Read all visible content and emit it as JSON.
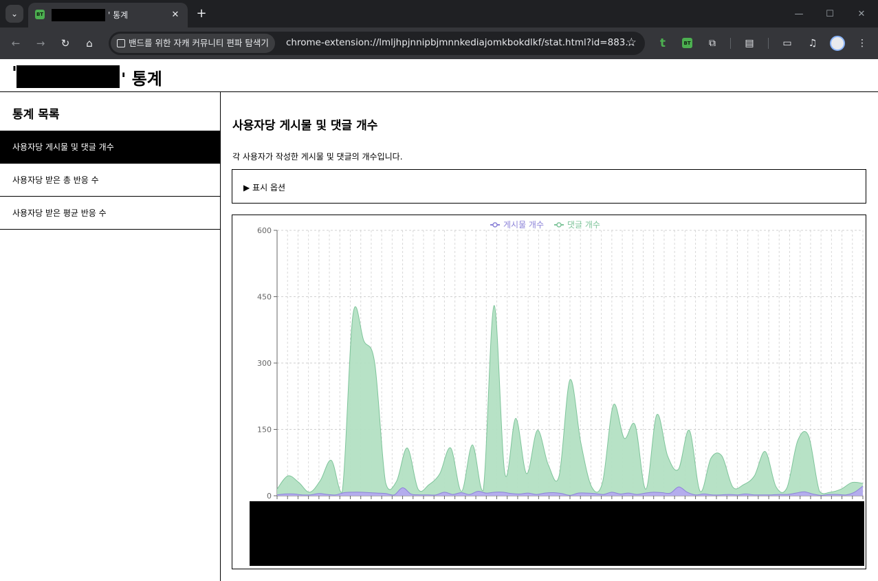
{
  "browser": {
    "tab_title": "' 통계",
    "tab_favicon": "BT",
    "new_tab_icon": "plus-icon",
    "site_chip": "밴드를 위한 자캐 커뮤니티 편파 탐색기",
    "url": "chrome-extension://lmljhpjnnipbjmnnkediajomkbokdlkf/stat.html?id=883...",
    "ext_t": "t",
    "ext_bt": "BT"
  },
  "header": {
    "quote": "'",
    "title": "' 통계"
  },
  "sidebar": {
    "title": "통계 목록",
    "items": [
      {
        "label": "사용자당 게시물 및 댓글 개수",
        "active": true
      },
      {
        "label": "사용자당 받은 총 반응 수",
        "active": false
      },
      {
        "label": "사용자당 받은 평균 반응 수",
        "active": false
      }
    ]
  },
  "main": {
    "title": "사용자당 게시물 및 댓글 개수",
    "description": "각 사용자가 작성한 게시물 및 댓글의 개수입니다.",
    "options_label": "▶ 표시 옵션"
  },
  "chart_data": {
    "type": "area",
    "title": "",
    "xlabel": "",
    "ylabel": "",
    "ylim": [
      0,
      600
    ],
    "yticks": [
      0,
      150,
      300,
      450,
      600
    ],
    "grid": true,
    "legend": "top-center",
    "series": [
      {
        "name": "게시물 개수",
        "color": "#8c83d8",
        "fill": "#b3aaef",
        "values": [
          2,
          4,
          4,
          2,
          2,
          5,
          3,
          2,
          7,
          8,
          8,
          7,
          6,
          5,
          2,
          18,
          4,
          2,
          2,
          2,
          8,
          3,
          7,
          3,
          10,
          6,
          8,
          8,
          5,
          4,
          6,
          3,
          6,
          7,
          5,
          1,
          6,
          6,
          5,
          3,
          8,
          4,
          6,
          3,
          6,
          8,
          7,
          6,
          20,
          8,
          2,
          4,
          2,
          2,
          3,
          2,
          4,
          2,
          2,
          2,
          3,
          3,
          6,
          9,
          4,
          1,
          3,
          3,
          2,
          8,
          22
        ]
      },
      {
        "name": "댓글 개수",
        "color": "#7ec49a",
        "fill": "#b3e0c3",
        "values": [
          15,
          45,
          30,
          8,
          35,
          80,
          8,
          410,
          350,
          300,
          30,
          32,
          108,
          15,
          25,
          50,
          108,
          10,
          115,
          12,
          430,
          50,
          175,
          50,
          148,
          70,
          45,
          262,
          120,
          20,
          30,
          205,
          130,
          160,
          15,
          183,
          90,
          60,
          148,
          10,
          85,
          90,
          20,
          25,
          45,
          100,
          20,
          18,
          125,
          135,
          10,
          8,
          15,
          30,
          28
        ]
      }
    ]
  }
}
